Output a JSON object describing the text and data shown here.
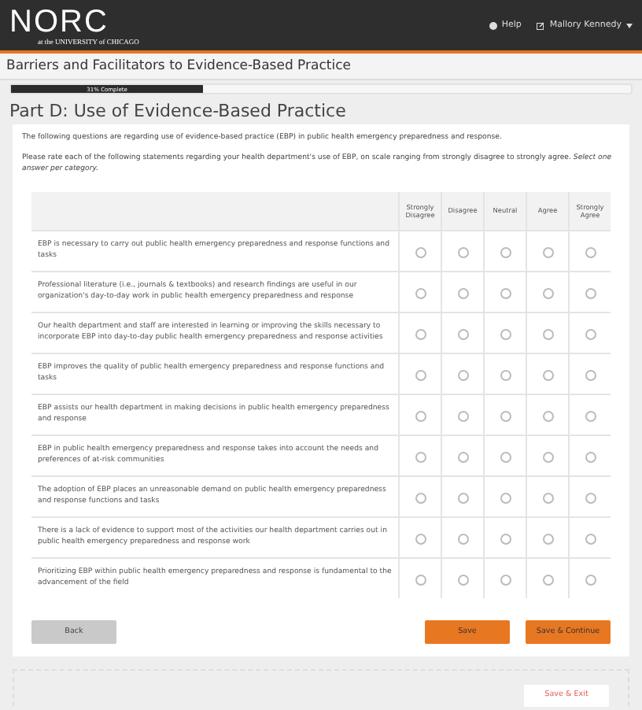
{
  "header": {
    "logo": "NORC",
    "logo_subtitle": "at the UNIVERSITY of CHICAGO",
    "help": "Help",
    "user": "Mallory Kennedy"
  },
  "survey_title": "Barriers and Facilitators to Evidence-Based Practice",
  "progress": {
    "label": "31% Complete",
    "level": 0.31
  },
  "part_title": "Part D: Use of Evidence-Based Practice",
  "intro": "The following questions are regarding use of evidence-based practice (EBP) in public health emergency preparedness and response.",
  "instructions": "Please rate each of the following statements regarding your health department's use of EBP, on scale ranging from strongly disagree to strongly agree. *Select one answer per category.*",
  "table": {
    "columns": [
      "Strongly Disagree",
      "Disagree",
      "Neutral",
      "Agree",
      "Strongly Agree"
    ],
    "rows": [
      {
        "statement": "EBP is necessary to carry out public health emergency preparedness and response functions and tasks",
        "selected": [
          false,
          false,
          false,
          false,
          false
        ]
      },
      {
        "statement": "Professional literature (i.e., journals & textbooks) and research findings are useful in our organization's day-to-day work in public health emergency preparedness and response",
        "selected": [
          false,
          false,
          false,
          false,
          false
        ]
      },
      {
        "statement": "Our health department and staff are interested in learning or improving the skills necessary to incorporate EBP into day-to-day public health emergency preparedness and response activities",
        "selected": [
          false,
          false,
          false,
          false,
          false
        ]
      },
      {
        "statement": "EBP improves the quality of public health emergency preparedness and response functions and tasks",
        "selected": [
          false,
          false,
          false,
          false,
          false
        ]
      },
      {
        "statement": "EBP assists our health department in making decisions in public health emergency preparedness and response",
        "selected": [
          false,
          false,
          false,
          false,
          false
        ]
      },
      {
        "statement": "EBP in public health emergency preparedness and response takes into account the needs and preferences of at-risk communities",
        "selected": [
          false,
          false,
          false,
          false,
          false
        ]
      },
      {
        "statement": "The adoption of EBP places an unreasonable demand on public health emergency preparedness and response functions and tasks",
        "selected": [
          false,
          false,
          false,
          false,
          false
        ]
      },
      {
        "statement": "There is a lack of evidence to support most of the activities our health department carries out in public health emergency preparedness and response work",
        "selected": [
          false,
          false,
          false,
          false,
          false
        ]
      },
      {
        "statement": "Prioritizing EBP within public health emergency preparedness and response is fundamental to the advancement of the field",
        "selected": [
          false,
          false,
          false,
          false,
          false
        ]
      }
    ]
  },
  "buttons": [
    {
      "label": "Back",
      "kind": "secondary"
    },
    {
      "label": "Save",
      "kind": "primary"
    },
    {
      "label": "Save & Continue",
      "kind": "primary"
    }
  ],
  "footer_button": "Save & Exit"
}
